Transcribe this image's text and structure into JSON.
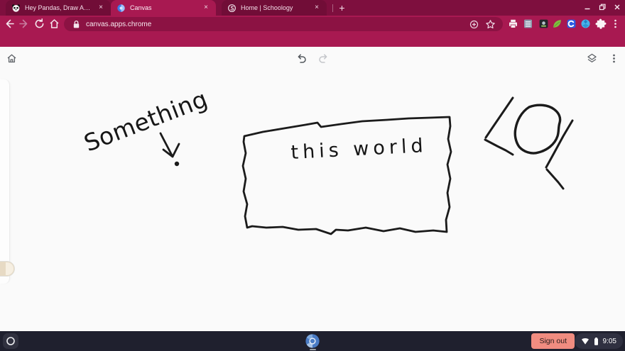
{
  "browser": {
    "tabs": [
      {
        "title": "Hey Pandas, Draw An Image Ou",
        "favicon": "panda-icon",
        "close": "×"
      },
      {
        "title": "Canvas",
        "favicon": "canvas-icon",
        "close": "×"
      },
      {
        "title": "Home | Schoology",
        "favicon": "schoology-icon",
        "close": "×"
      }
    ],
    "new_tab_label": "+",
    "address": "canvas.apps.chrome",
    "theme": {
      "frame": "#7E0F3E",
      "toolbar": "#A81951",
      "omnibox": "#8C1243",
      "ink": "#1B1B1B"
    },
    "extension_icons": [
      "printer-icon",
      "sheets-icon",
      "camera-ext-icon",
      "leaf-icon",
      "c-logo-icon",
      "globe-icon",
      "puzzle-icon",
      "kebab-menu-icon"
    ]
  },
  "canvas_app": {
    "toolbar_icons": [
      "home-icon",
      "undo-icon",
      "redo-icon",
      "layers-icon",
      "kebab-menu-icon"
    ]
  },
  "drawing": {
    "label_text": "Something",
    "box_text": "this world",
    "doodle_text": "LOL"
  },
  "shelf": {
    "sign_out_label": "Sign out",
    "time": "9:05",
    "status_icons": [
      "wifi-icon",
      "battery-icon"
    ]
  }
}
